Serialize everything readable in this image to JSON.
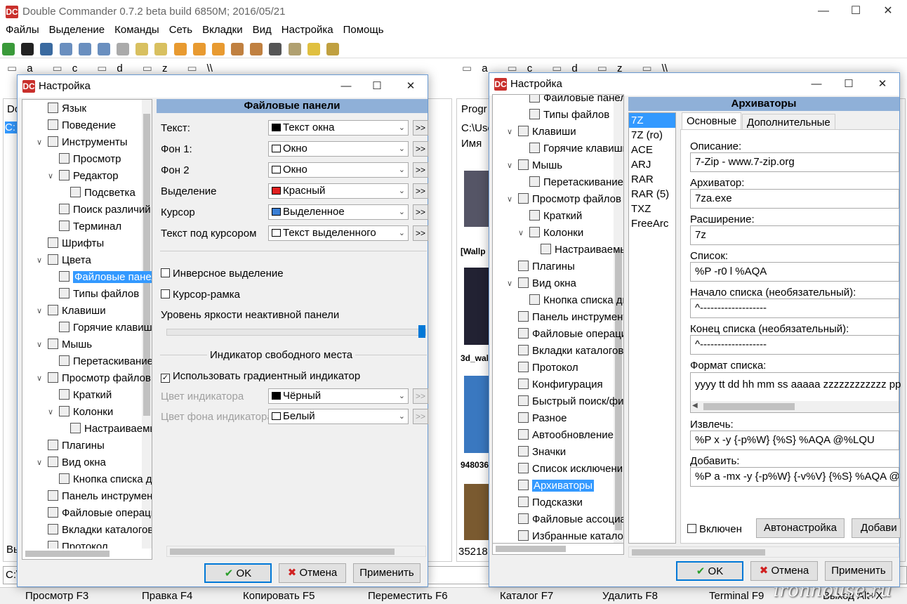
{
  "app": {
    "title": "Double Commander 0.7.2 beta build 6850M; 2016/05/21",
    "menu": [
      "Файлы",
      "Выделение",
      "Команды",
      "Сеть",
      "Вкладки",
      "Вид",
      "Настройка",
      "Помощь"
    ]
  },
  "drives_left": [
    "a",
    "c",
    "d",
    "z",
    "\\\\"
  ],
  "drives_right": [
    "a",
    "c",
    "d",
    "z",
    "\\\\"
  ],
  "background": {
    "left_path_fragment": "C:",
    "left_tab": "Do",
    "right_tab": "Progr",
    "right_path": "C:\\Use",
    "right_col_name": "Имя",
    "right_items": [
      "[Wallp",
      "3d_wal",
      "948036",
      "35218"
    ],
    "left_status": "Вы",
    "cmdline": "C:\\"
  },
  "fnkeys": [
    "Просмотр F3",
    "Правка F4",
    "Копировать F5",
    "Переместить F6",
    "Каталог F7",
    "Удалить F8",
    "Terminal F9",
    "Выход Alt+X"
  ],
  "watermark": "ironhouse.ru",
  "dialog1": {
    "title": "Настройка",
    "tree": [
      {
        "label": "Язык",
        "level": 0
      },
      {
        "label": "Поведение",
        "level": 0
      },
      {
        "label": "Инструменты",
        "level": 0,
        "expander": "v"
      },
      {
        "label": "Просмотр",
        "level": 1
      },
      {
        "label": "Редактор",
        "level": 1,
        "expander": "v"
      },
      {
        "label": "Подсветка",
        "level": 2
      },
      {
        "label": "Поиск различий",
        "level": 1
      },
      {
        "label": "Терминал",
        "level": 1
      },
      {
        "label": "Шрифты",
        "level": 0
      },
      {
        "label": "Цвета",
        "level": 0,
        "expander": "v"
      },
      {
        "label": "Файловые панели",
        "level": 1,
        "selected": true
      },
      {
        "label": "Типы файлов",
        "level": 1
      },
      {
        "label": "Клавиши",
        "level": 0,
        "expander": "v"
      },
      {
        "label": "Горячие клавиши",
        "level": 1
      },
      {
        "label": "Мышь",
        "level": 0,
        "expander": "v"
      },
      {
        "label": "Перетаскивание",
        "level": 1
      },
      {
        "label": "Просмотр файлов",
        "level": 0,
        "expander": "v"
      },
      {
        "label": "Краткий",
        "level": 1
      },
      {
        "label": "Колонки",
        "level": 1,
        "expander": "v"
      },
      {
        "label": "Настраиваемые",
        "level": 2
      },
      {
        "label": "Плагины",
        "level": 0
      },
      {
        "label": "Вид окна",
        "level": 0,
        "expander": "v"
      },
      {
        "label": "Кнопка списка ди",
        "level": 1
      },
      {
        "label": "Панель инструмент",
        "level": 0
      },
      {
        "label": "Файловые операци",
        "level": 0
      },
      {
        "label": "Вкладки каталогов",
        "level": 0
      },
      {
        "label": "Протокол",
        "level": 0
      }
    ],
    "header": "Файловые панели",
    "colors": [
      {
        "label": "Текст:",
        "value": "Текст окна",
        "swatch": "#000000"
      },
      {
        "label": "Фон 1:",
        "value": "Окно",
        "swatch": "#ffffff"
      },
      {
        "label": "Фон 2",
        "value": "Окно",
        "swatch": "#ffffff"
      },
      {
        "label": "Выделение",
        "value": "Красный",
        "swatch": "#e02020"
      },
      {
        "label": "Курсор",
        "value": "Выделенное",
        "swatch": "#3a7fd5"
      },
      {
        "label": "Текст под курсором",
        "value": "Текст выделенного",
        "swatch": "#ffffff"
      }
    ],
    "more": ">>",
    "inverse_selection": "Инверсное выделение",
    "cursor_frame": "Курсор-рамка",
    "brightness_label": "Уровень яркости неактивной панели",
    "brightness_level": 1.0,
    "free_space_group": "Индикатор свободного места",
    "use_gradient": "Использовать градиентный индикатор",
    "indicator_color_label": "Цвет индикатора",
    "indicator_color_value": "Чёрный",
    "indicator_bg_label": "Цвет фона индикатора",
    "indicator_bg_value": "Белый",
    "ok": "OK",
    "cancel": "Отмена",
    "apply": "Применить"
  },
  "dialog2": {
    "title": "Настройка",
    "tree": [
      {
        "label": "Файловые панели",
        "level": 1
      },
      {
        "label": "Типы файлов",
        "level": 1
      },
      {
        "label": "Клавиши",
        "level": 0,
        "expander": "v"
      },
      {
        "label": "Горячие клавиши",
        "level": 1
      },
      {
        "label": "Мышь",
        "level": 0,
        "expander": "v"
      },
      {
        "label": "Перетаскивание",
        "level": 1
      },
      {
        "label": "Просмотр файлов",
        "level": 0,
        "expander": "v"
      },
      {
        "label": "Краткий",
        "level": 1
      },
      {
        "label": "Колонки",
        "level": 1,
        "expander": "v"
      },
      {
        "label": "Настраиваемые",
        "level": 2
      },
      {
        "label": "Плагины",
        "level": 0
      },
      {
        "label": "Вид окна",
        "level": 0,
        "expander": "v"
      },
      {
        "label": "Кнопка списка ди",
        "level": 1
      },
      {
        "label": "Панель инструмент",
        "level": 0
      },
      {
        "label": "Файловые операци",
        "level": 0
      },
      {
        "label": "Вкладки каталогов",
        "level": 0
      },
      {
        "label": "Протокол",
        "level": 0
      },
      {
        "label": "Конфигурация",
        "level": 0
      },
      {
        "label": "Быстрый поиск/фи",
        "level": 0
      },
      {
        "label": "Разное",
        "level": 0
      },
      {
        "label": "Автообновление",
        "level": 0
      },
      {
        "label": "Значки",
        "level": 0
      },
      {
        "label": "Список исключени",
        "level": 0
      },
      {
        "label": "Архиваторы",
        "level": 0,
        "selected": true
      },
      {
        "label": "Подсказки",
        "level": 0
      },
      {
        "label": "Файловые ассоциа",
        "level": 0
      },
      {
        "label": "Избранные катало",
        "level": 0
      }
    ],
    "header": "Архиваторы",
    "archivers": [
      "7Z",
      "7Z (ro)",
      "ACE",
      "ARJ",
      "RAR",
      "RAR (5)",
      "TXZ",
      "FreeArc"
    ],
    "selected_archiver": "7Z",
    "tabs": [
      "Основные",
      "Дополнительные"
    ],
    "fields": [
      {
        "label": "Описание:",
        "value": "7-Zip - www.7-zip.org"
      },
      {
        "label": "Архиватор:",
        "value": "7za.exe"
      },
      {
        "label": "Расширение:",
        "value": "7z"
      },
      {
        "label": "Список:",
        "value": "%P -r0 l %AQA"
      },
      {
        "label": "Начало списка (необязательный):",
        "value": "^-------------------"
      },
      {
        "label": "Конец списка (необязательный):",
        "value": "^-------------------"
      }
    ],
    "format_label": "Формат списка:",
    "format_value": "yyyy tt dd hh mm ss aaaaa zzzzzzzzzzzz pp",
    "extract_label": "Извлечь:",
    "extract_value": "%P x -y {-p%W} {%S} %AQA @%LQU",
    "add_label": "Добавить:",
    "add_value": "%P a -mx -y {-p%W} {-v%V} {%S} %AQA @",
    "enabled": "Включен",
    "autosetup": "Автонастройка",
    "add_button": "Добави",
    "ok": "OK",
    "cancel": "Отмена",
    "apply": "Применить"
  }
}
